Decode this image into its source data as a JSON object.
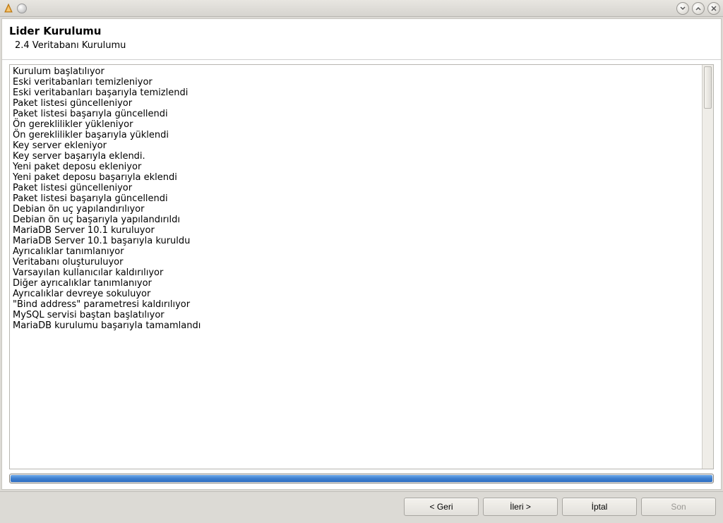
{
  "header": {
    "title": "Lider Kurulumu",
    "subtitle": "2.4 Veritabanı Kurulumu"
  },
  "log_lines": [
    "Kurulum başlatılıyor",
    "Eski veritabanları temizleniyor",
    "Eski veritabanları başarıyla temizlendi",
    "Paket listesi güncelleniyor",
    "Paket listesi başarıyla güncellendi",
    "Ön gereklilikler yükleniyor",
    "Ön gereklilikler başarıyla yüklendi",
    "Key server ekleniyor",
    "Key server başarıyla eklendi.",
    "Yeni paket deposu ekleniyor",
    "Yeni paket deposu başarıyla eklendi",
    "Paket listesi güncelleniyor",
    "Paket listesi başarıyla güncellendi",
    "Debian ön uç yapılandırılıyor",
    "Debian ön uç başarıyla yapılandırıldı",
    "MariaDB Server 10.1 kuruluyor",
    "MariaDB Server 10.1 başarıyla kuruldu",
    "Ayrıcalıklar tanımlanıyor",
    "Veritabanı oluşturuluyor",
    "Varsayılan kullanıcılar kaldırılıyor",
    "Diğer ayrıcalıklar tanımlanıyor",
    "Ayrıcalıklar devreye sokuluyor",
    "\"Bind address\" parametresi kaldırılıyor",
    "MySQL servisi baştan başlatılıyor",
    "MariaDB kurulumu başarıyla tamamlandı"
  ],
  "progress": {
    "percent": 100
  },
  "buttons": {
    "back": "< Geri",
    "next": "İleri >",
    "cancel": "İptal",
    "finish": "Son"
  }
}
